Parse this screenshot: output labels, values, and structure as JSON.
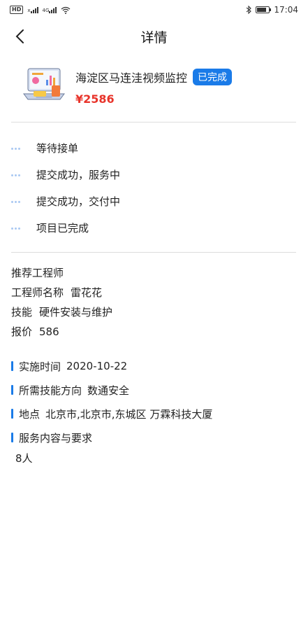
{
  "status_bar": {
    "time": "17:04",
    "left_badge": "HD",
    "network_x": "x",
    "network_4g": "4G",
    "icons": [
      "hd-icon",
      "signal-icon",
      "signal-4g-icon",
      "wifi-icon",
      "bluetooth-icon",
      "battery-icon"
    ]
  },
  "nav": {
    "title": "详情",
    "back_icon": "chevron-left-icon"
  },
  "project": {
    "title": "海淀区马连洼视频监控",
    "status_badge": "已完成",
    "price": "¥2586",
    "thumbnail_icon": "laptop-dashboard-illustration"
  },
  "steps": [
    {
      "label": "等待接单"
    },
    {
      "label": "提交成功，服务中"
    },
    {
      "label": "提交成功，交付中"
    },
    {
      "label": "项目已完成"
    }
  ],
  "engineer": {
    "heading": "推荐工程师",
    "name_label": "工程师名称",
    "name_value": "雷花花",
    "skill_label": "技能",
    "skill_value": "硬件安装与维护",
    "quote_label": "报价",
    "quote_value": "586"
  },
  "info": {
    "date_label": "实施时间",
    "date_value": "2020-10-22",
    "skill_dir_label": "所需技能方向",
    "skill_dir_value": "数通安全",
    "address_label": "地点",
    "address_value": "北京市,北京市,东城区 万霖科技大厦",
    "service_label": "服务内容与要求",
    "service_value": "8人"
  },
  "colors": {
    "accent": "#1a7be8",
    "price": "#e8332a",
    "step_dot": "#a9c9f2",
    "divider": "#dddddd"
  }
}
